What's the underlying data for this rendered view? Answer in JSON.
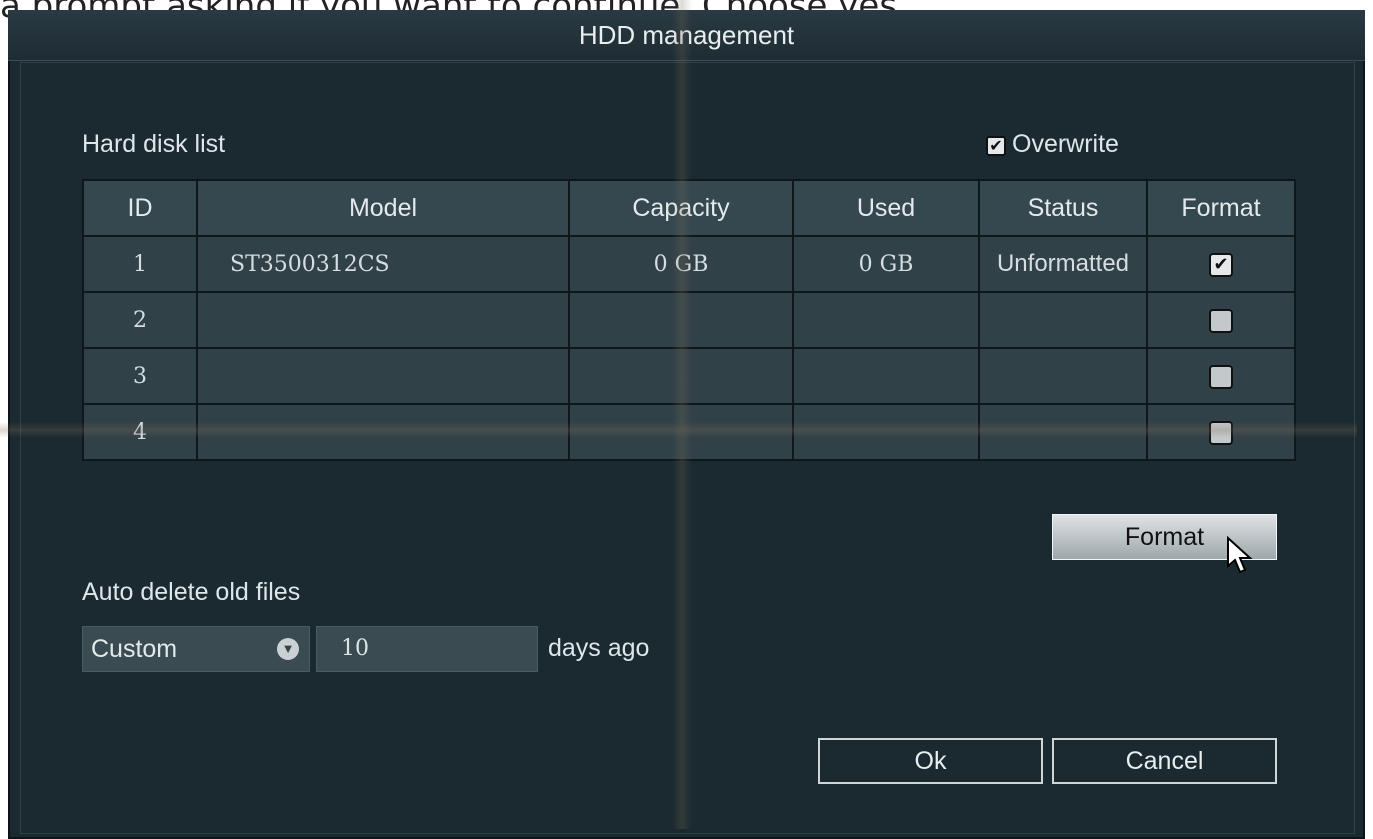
{
  "caption": "a prompt asking if you want to continue. Choose yes.",
  "window": {
    "title": "HDD management"
  },
  "list": {
    "heading": "Hard disk list",
    "overwrite_label": "Overwrite",
    "overwrite_checked": true,
    "columns": [
      "ID",
      "Model",
      "Capacity",
      "Used",
      "Status",
      "Format"
    ],
    "rows": [
      {
        "id": "1",
        "model": "ST3500312CS",
        "capacity": "0 GB",
        "used": "0 GB",
        "status": "Unformatted",
        "format_checked": true
      },
      {
        "id": "2",
        "model": "",
        "capacity": "",
        "used": "",
        "status": "",
        "format_checked": false
      },
      {
        "id": "3",
        "model": "",
        "capacity": "",
        "used": "",
        "status": "",
        "format_checked": false
      },
      {
        "id": "4",
        "model": "",
        "capacity": "",
        "used": "",
        "status": "",
        "format_checked": false
      }
    ]
  },
  "actions": {
    "format_label": "Format"
  },
  "auto_delete": {
    "heading": "Auto delete old files",
    "mode": "Custom",
    "days": "10",
    "suffix": "days ago"
  },
  "footer": {
    "ok_label": "Ok",
    "cancel_label": "Cancel"
  },
  "icons": {
    "check": "check-icon",
    "dropdown": "dropdown-arrow-icon",
    "cursor": "mouse-pointer-icon"
  }
}
